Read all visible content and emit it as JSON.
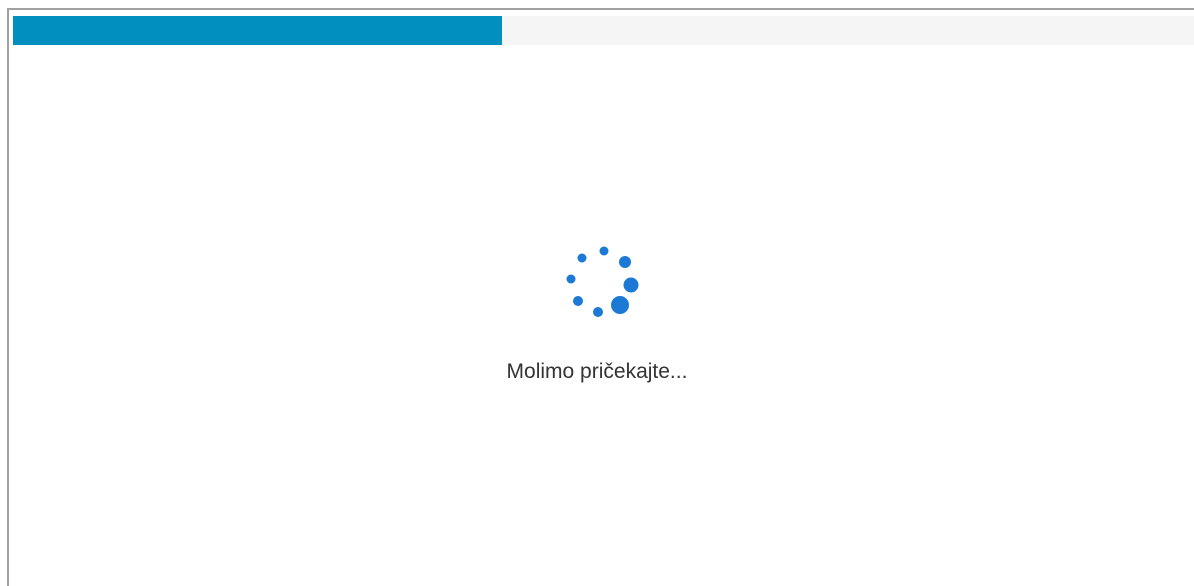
{
  "loading": {
    "message": "Molimo pričekajte...",
    "progress": 0.414
  },
  "colors": {
    "progress_fill": "#008fbe",
    "progress_track": "#f5f5f5",
    "spinner": "#1c7ad6"
  },
  "icons": {
    "spinner": "loading-spinner-icon"
  }
}
